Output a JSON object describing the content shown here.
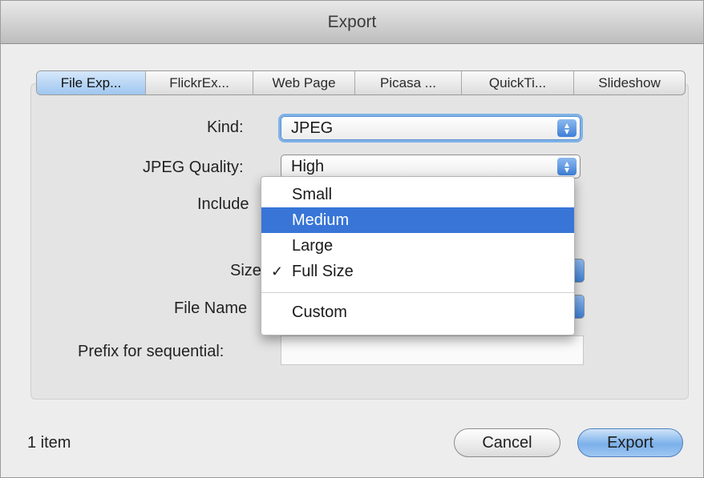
{
  "window": {
    "title": "Export"
  },
  "tabs": [
    {
      "label": "File Exp...",
      "active": true
    },
    {
      "label": "FlickrEx...",
      "active": false
    },
    {
      "label": "Web Page",
      "active": false
    },
    {
      "label": "Picasa ...",
      "active": false
    },
    {
      "label": "QuickTi...",
      "active": false
    },
    {
      "label": "Slideshow",
      "active": false
    }
  ],
  "form": {
    "kind": {
      "label": "Kind:",
      "value": "JPEG"
    },
    "jpeg_quality": {
      "label": "JPEG Quality:",
      "value": "High"
    },
    "include": {
      "label": "Include"
    },
    "size": {
      "label": "Size"
    },
    "file_name": {
      "label": "File Name"
    },
    "prefix": {
      "label": "Prefix for sequential:",
      "value": ""
    }
  },
  "size_menu": {
    "items": [
      {
        "label": "Small",
        "highlighted": false,
        "checked": false
      },
      {
        "label": "Medium",
        "highlighted": true,
        "checked": false
      },
      {
        "label": "Large",
        "highlighted": false,
        "checked": false
      },
      {
        "label": "Full Size",
        "highlighted": false,
        "checked": true
      }
    ],
    "extra_items": [
      {
        "label": "Custom"
      }
    ],
    "check_glyph": "✓"
  },
  "footer": {
    "item_count": "1 item",
    "cancel_label": "Cancel",
    "export_label": "Export"
  },
  "colors": {
    "highlight": "#3875d7",
    "default_button": "#7bb0ea",
    "focus_ring": "#7fb2e8"
  },
  "icons": {
    "popup_arrows": "up-down-chevron-icon",
    "checkmark": "checkmark-icon"
  }
}
